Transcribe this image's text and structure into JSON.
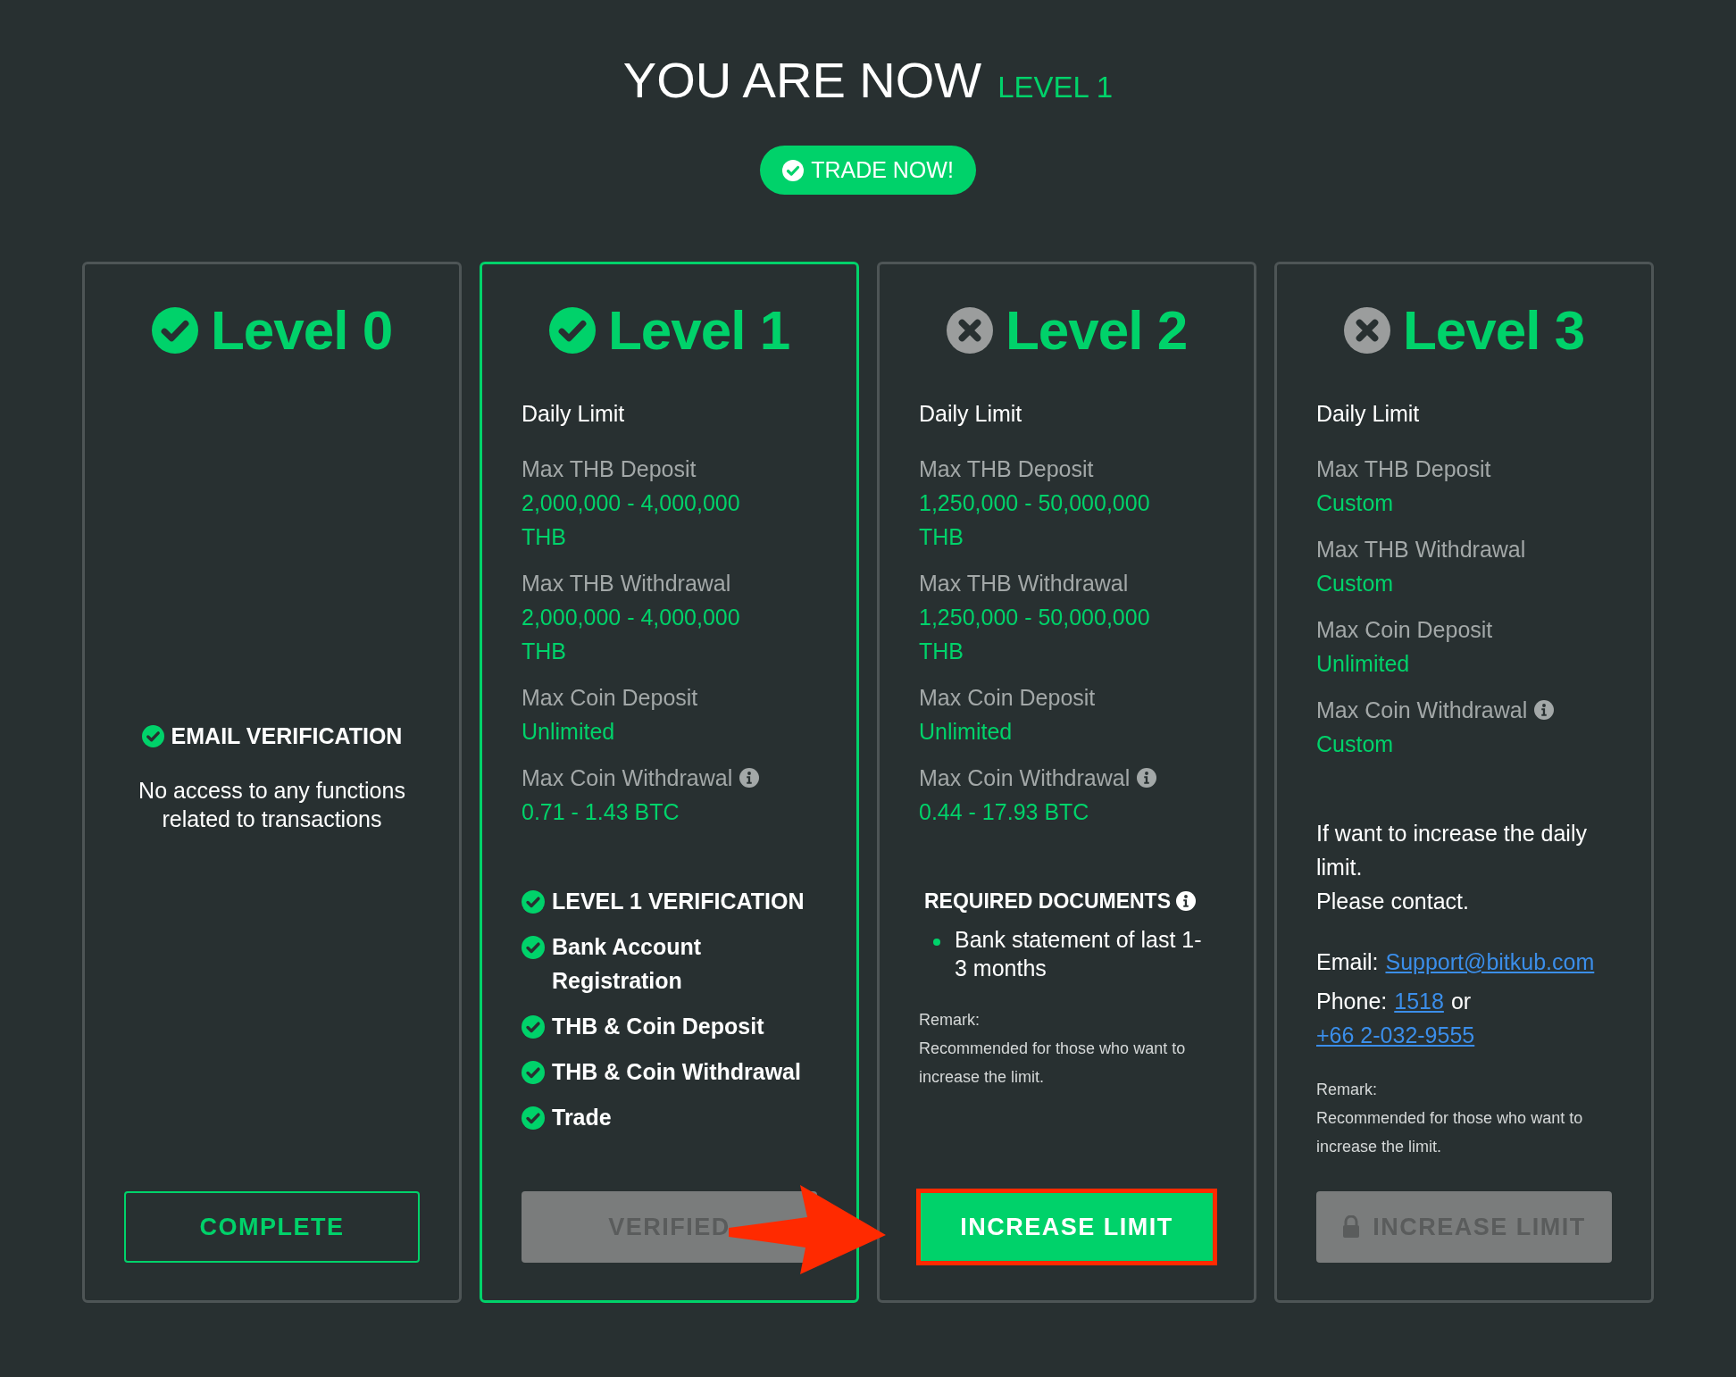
{
  "header": {
    "title": "YOU ARE NOW",
    "level_label": "LEVEL 1"
  },
  "trade_button": {
    "label": "TRADE NOW!"
  },
  "levels": [
    {
      "title": "Level 0",
      "achieved": true,
      "selected": false,
      "sections": [
        {
          "kind": "summary",
          "items": [
            {
              "text": "EMAIL VERIFICATION",
              "checked": true
            }
          ],
          "note": "No access to any functions related to transactions"
        }
      ],
      "button": {
        "label": "COMPLETE",
        "kind": "outline",
        "highlighted": false
      }
    },
    {
      "title": "Level 1",
      "achieved": true,
      "selected": true,
      "sections": [
        {
          "kind": "limits",
          "heading": "Daily Limit",
          "items": [
            {
              "label": "Max THB Deposit",
              "value": "2,000,000 - 4,000,000 THB",
              "info": false
            },
            {
              "label": "Max THB Withdrawal",
              "value": "2,000,000 - 4,000,000 THB",
              "info": false
            },
            {
              "label": "Max Coin Deposit",
              "value": "Unlimited",
              "info": false
            },
            {
              "label": "Max Coin Withdrawal",
              "value": "0.71 - 1.43 BTC",
              "info": true
            }
          ]
        },
        {
          "kind": "checklist",
          "items": [
            {
              "text": "LEVEL 1 VERIFICATION",
              "checked": true
            },
            {
              "text": "Bank Account Registration",
              "checked": true
            },
            {
              "text": "THB & Coin Deposit",
              "checked": true
            },
            {
              "text": "THB & Coin Withdrawal",
              "checked": true
            },
            {
              "text": "Trade",
              "checked": true
            }
          ]
        }
      ],
      "button": {
        "label": "VERIFIED",
        "kind": "disabled",
        "highlighted": false
      }
    },
    {
      "title": "Level 2",
      "achieved": false,
      "selected": false,
      "sections": [
        {
          "kind": "limits",
          "heading": "Daily Limit",
          "items": [
            {
              "label": "Max THB Deposit",
              "value": "1,250,000 - 50,000,000 THB",
              "info": false
            },
            {
              "label": "Max THB Withdrawal",
              "value": "1,250,000 - 50,000,000 THB",
              "info": false
            },
            {
              "label": "Max Coin Deposit",
              "value": "Unlimited",
              "info": false
            },
            {
              "label": "Max Coin Withdrawal",
              "value": "0.44 - 17.93 BTC",
              "info": true
            }
          ]
        },
        {
          "kind": "documents",
          "title": "REQUIRED DOCUMENTS",
          "info": true,
          "items": [
            "Bank statement of last 1-3 months"
          ]
        },
        {
          "kind": "remark",
          "label": "Remark:",
          "text": "Recommended for those who want to increase the limit."
        }
      ],
      "button": {
        "label": "INCREASE LIMIT",
        "kind": "primary",
        "highlighted": true
      }
    },
    {
      "title": "Level 3",
      "achieved": false,
      "selected": false,
      "sections": [
        {
          "kind": "limits",
          "heading": "Daily Limit",
          "items": [
            {
              "label": "Max THB Deposit",
              "value": "Custom",
              "info": false
            },
            {
              "label": "Max THB Withdrawal",
              "value": "Custom",
              "info": false
            },
            {
              "label": "Max Coin Deposit",
              "value": "Unlimited",
              "info": false
            },
            {
              "label": "Max Coin Withdrawal",
              "value": "Custom",
              "info": true
            }
          ]
        },
        {
          "kind": "contact",
          "lines": [
            "If want to increase the daily limit.",
            "Please contact."
          ],
          "rows": [
            {
              "label": "Email:",
              "parts": [
                {
                  "kind": "link",
                  "text": "Support@bitkub.com"
                }
              ]
            },
            {
              "label": "Phone:",
              "parts": [
                {
                  "kind": "link",
                  "text": "1518"
                },
                {
                  "kind": "text",
                  "text": "or"
                },
                {
                  "kind": "link",
                  "text": "+66 2-032-9555"
                }
              ]
            }
          ]
        },
        {
          "kind": "remark",
          "label": "Remark:",
          "text": "Recommended for those who want to increase the limit."
        }
      ],
      "button": {
        "label": "INCREASE LIMIT",
        "kind": "locked",
        "highlighted": false
      }
    }
  ],
  "annotations": [
    {
      "kind": "arrow"
    }
  ]
}
